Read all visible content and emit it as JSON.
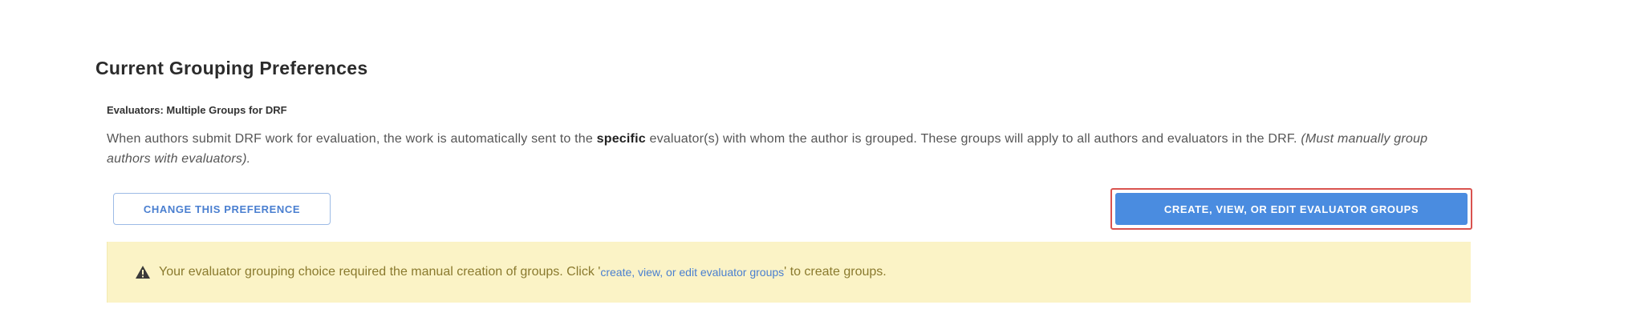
{
  "section": {
    "heading": "Current Grouping Preferences",
    "subheading": "Evaluators: Multiple Groups for DRF",
    "description_part1": "When authors submit DRF work for evaluation, the work is automatically sent to the ",
    "description_bold": "specific",
    "description_part2": " evaluator(s) with whom the author is grouped. These groups will apply to all authors and evaluators in the DRF. ",
    "description_italic": "(Must manually group authors with evaluators)."
  },
  "buttons": {
    "change_preference": "CHANGE THIS PREFERENCE",
    "edit_groups": "CREATE, VIEW, OR EDIT EVALUATOR GROUPS"
  },
  "alert": {
    "icon": "warning-icon",
    "text_before": "Your evaluator grouping choice required the manual creation of groups. Click '",
    "link_text": "create, view, or edit evaluator groups",
    "text_after": "' to create groups."
  },
  "colors": {
    "primary": "#4a8ce0",
    "highlight_border": "#d9534f",
    "alert_bg": "#fbf3c6"
  }
}
